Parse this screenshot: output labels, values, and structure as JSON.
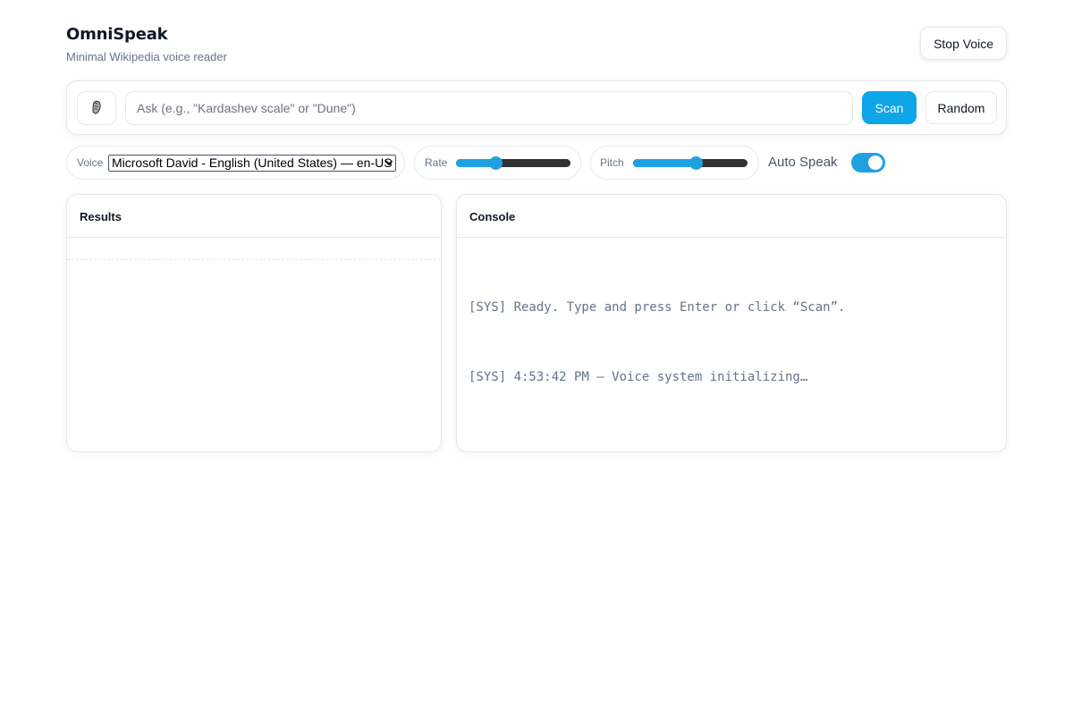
{
  "app": {
    "title": "OmniSpeak",
    "subtitle": "Minimal Wikipedia voice reader",
    "stop_voice_label": "Stop Voice"
  },
  "search": {
    "mic_icon": "microphone-icon",
    "placeholder": "Ask (e.g., \"Kardashev scale\" or \"Dune\")",
    "value": "",
    "scan_label": "Scan",
    "random_label": "Random"
  },
  "controls": {
    "voice_label": "Voice",
    "voice_selected": "Microsoft David - English (United States) — en-US",
    "rate_label": "Rate",
    "rate_fraction": 0.35,
    "pitch_label": "Pitch",
    "pitch_fraction": 0.55,
    "auto_speak_label": "Auto Speak",
    "auto_speak_on": true
  },
  "results": {
    "title": "Results"
  },
  "console": {
    "title": "Console",
    "lines": [
      "[SYS] Ready. Type and press Enter or click “Scan”.",
      "[SYS] 4:53:42 PM — Voice system initializing…"
    ]
  },
  "colors": {
    "accent": "#0ea5e9",
    "slider_fill": "#1fa1e0",
    "slider_track": "#2f3133",
    "border": "#e2e8f0",
    "muted_text": "#64748b"
  }
}
